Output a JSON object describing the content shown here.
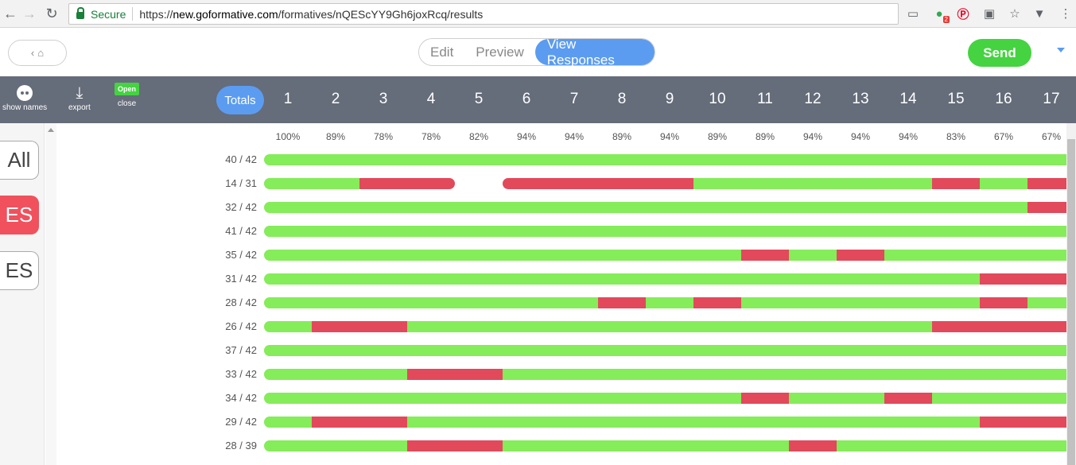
{
  "browser": {
    "secure_label": "Secure",
    "url_prefix": "https://",
    "url_host": "new.goformative.com",
    "url_path": "/formatives/nQEScYY9Gh6joxRcq/results",
    "extension_badge": "2"
  },
  "header": {
    "tabs": [
      "Edit",
      "Preview",
      "View Responses"
    ],
    "active_tab": "View Responses",
    "send_label": "Send"
  },
  "toolbar": {
    "show_names_label": "show names",
    "export_label": "export",
    "open_badge": "Open",
    "close_label": "close",
    "totals_label": "Totals",
    "questions": [
      "1",
      "2",
      "3",
      "4",
      "5",
      "6",
      "7",
      "8",
      "9",
      "10",
      "11",
      "12",
      "13",
      "14",
      "15",
      "16",
      "17"
    ]
  },
  "sidebar": {
    "items": [
      "All",
      "ES",
      "ES"
    ]
  },
  "results": {
    "percentages": [
      "100%",
      "89%",
      "78%",
      "78%",
      "82%",
      "94%",
      "94%",
      "89%",
      "94%",
      "89%",
      "89%",
      "94%",
      "94%",
      "94%",
      "83%",
      "67%",
      "67%"
    ],
    "rows": [
      {
        "score": "40 / 42",
        "cells": "GGGGGGGGGGGGGGGGG"
      },
      {
        "score": "14 / 31",
        "cells": "GGRR.RRRRGGGGGRGR"
      },
      {
        "score": "32 / 42",
        "cells": "GGGGGGGGGGGGGGGGR"
      },
      {
        "score": "41 / 42",
        "cells": "GGGGGGGGGGGGGGGGG"
      },
      {
        "score": "35 / 42",
        "cells": "GGGGGGGGGGRGRGGGG"
      },
      {
        "score": "31 / 42",
        "cells": "GGGGGGGGGGGGGGGRR"
      },
      {
        "score": "28 / 42",
        "cells": "GGGGGGGRGRGGGGGRG"
      },
      {
        "score": "26 / 42",
        "cells": "GRRGGGGGGGGGGGRRR"
      },
      {
        "score": "37 / 42",
        "cells": "GGGGGGGGGGGGGGGGG"
      },
      {
        "score": "33 / 42",
        "cells": "GGGRRGGGGGGGGGGGG"
      },
      {
        "score": "34 / 42",
        "cells": "GGGGGGGGGGRGGRGGG"
      },
      {
        "score": "29 / 42",
        "cells": "GRRGGGGGGGGGGGGRR"
      },
      {
        "score": "28 / 39",
        "cells": "GGGRRGGGGGGRGGGGG"
      }
    ]
  }
}
